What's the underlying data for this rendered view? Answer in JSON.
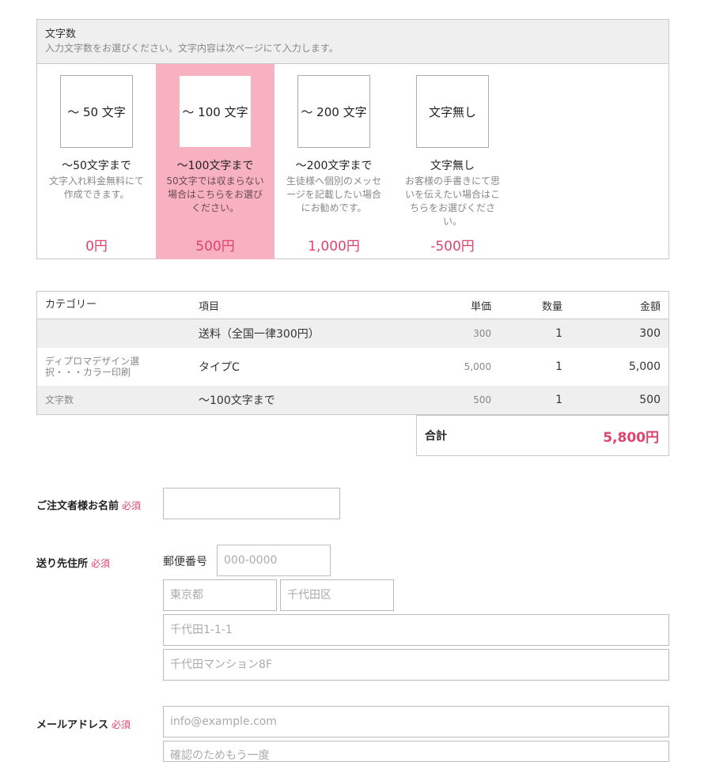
{
  "panel": {
    "title": "文字数",
    "description": "入力文字数をお選びください。文字内容は次ページにて入力します。",
    "options": [
      {
        "box": "〜 50 文字",
        "name": "〜50文字まで",
        "desc": "文字入れ料金無料にて作成できます。",
        "price": "0円",
        "selected": false
      },
      {
        "box": "〜 100 文字",
        "name": "〜100文字まで",
        "desc": "50文字では収まらない場合はこちらをお選びください。",
        "price": "500円",
        "selected": true
      },
      {
        "box": "〜 200 文字",
        "name": "〜200文字まで",
        "desc": "生徒様へ個別のメッセージを記載したい場合にお勧めです。",
        "price": "1,000円",
        "selected": false
      },
      {
        "box": "文字無し",
        "name": "文字無し",
        "desc": "お客様の手書きにて思いを伝えたい場合はこちらをお選びください。",
        "price": "-500円",
        "selected": false
      }
    ]
  },
  "table": {
    "headers": {
      "category": "カテゴリー",
      "item": "項目",
      "unit": "単価",
      "qty": "数量",
      "amount": "金額"
    },
    "rows": [
      {
        "category": "",
        "item": "送料（全国一律300円）",
        "unit": "300",
        "qty": "1",
        "amount": "300"
      },
      {
        "category": "ディプロマデザイン選択・・・カラー印刷",
        "item": "タイプC",
        "unit": "5,000",
        "qty": "1",
        "amount": "5,000"
      },
      {
        "category": "文字数",
        "item": "〜100文字まで",
        "unit": "500",
        "qty": "1",
        "amount": "500"
      }
    ],
    "total_label": "合計",
    "total_value": "5,800円"
  },
  "form": {
    "required": "必須",
    "name_label": "ご注文者様お名前",
    "address_label": "送り先住所",
    "zip_label": "郵便番号",
    "zip_placeholder": "000-0000",
    "pref_placeholder": "東京都",
    "city_placeholder": "千代田区",
    "street_placeholder": "千代田1-1-1",
    "building_placeholder": "千代田マンション8F",
    "email_label": "メールアドレス",
    "email_placeholder": "info@example.com",
    "email_confirm_placeholder": "確認のためもう一度"
  },
  "colors": {
    "accent": "#e0436b",
    "selected_bg": "#f7b1c0",
    "header_bg": "#efefef"
  }
}
